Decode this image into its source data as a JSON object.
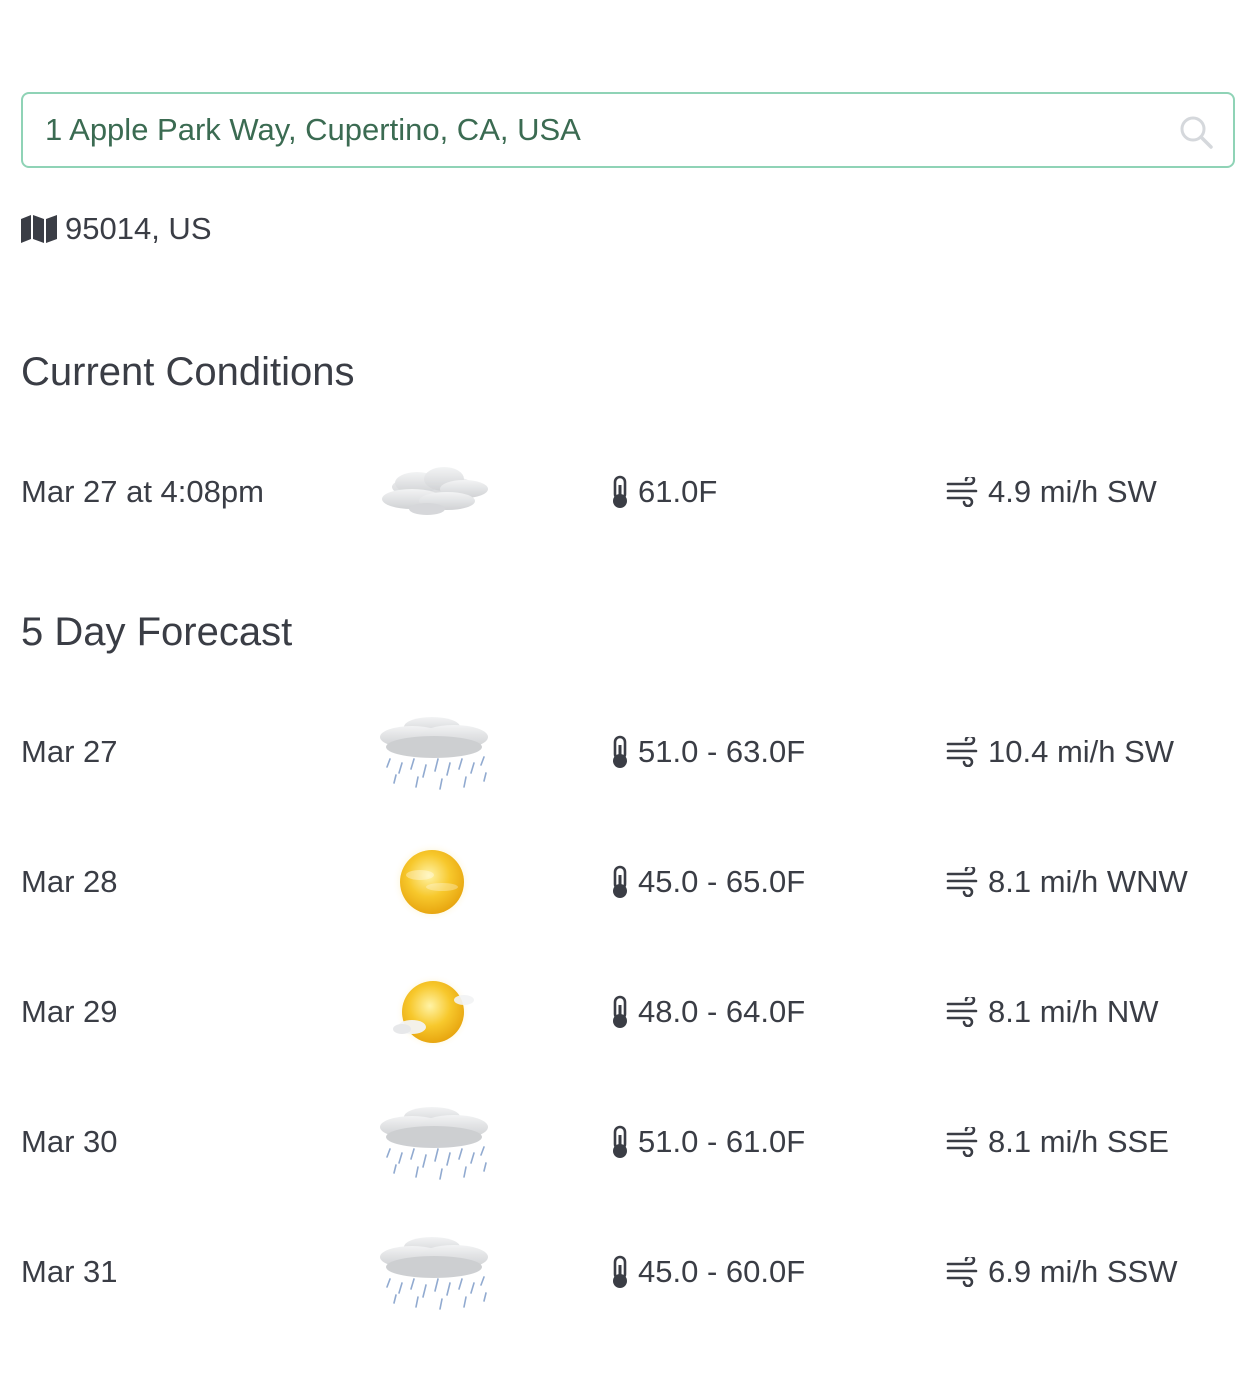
{
  "search": {
    "value": "1 Apple Park Way, Cupertino, CA, USA",
    "placeholder": "",
    "icon": "search-icon"
  },
  "location": {
    "icon": "map-icon",
    "text": "95014, US"
  },
  "current": {
    "title": "Current Conditions",
    "date": "Mar 27 at 4:08pm",
    "condition_icon": "cloudy",
    "temp": "61.0F",
    "wind": "4.9 mi/h SW"
  },
  "forecast": {
    "title": "5 Day Forecast",
    "days": [
      {
        "date": "Mar 27",
        "condition_icon": "rain",
        "temp": "51.0 - 63.0F",
        "wind": "10.4 mi/h SW"
      },
      {
        "date": "Mar 28",
        "condition_icon": "sunny",
        "temp": "45.0 - 65.0F",
        "wind": "8.1 mi/h WNW"
      },
      {
        "date": "Mar 29",
        "condition_icon": "mostly-sunny",
        "temp": "48.0 - 64.0F",
        "wind": "8.1 mi/h NW"
      },
      {
        "date": "Mar 30",
        "condition_icon": "rain",
        "temp": "51.0 - 61.0F",
        "wind": "8.1 mi/h SSE"
      },
      {
        "date": "Mar 31",
        "condition_icon": "rain",
        "temp": "45.0 - 60.0F",
        "wind": "6.9 mi/h SSW"
      }
    ]
  },
  "colors": {
    "text": "#3a3d45",
    "input_text": "#3b6b52",
    "input_border": "#8fd3b6",
    "sun": "#f5c02a",
    "cloud": "#d4d6d9",
    "rain": "#7e9cc8"
  }
}
